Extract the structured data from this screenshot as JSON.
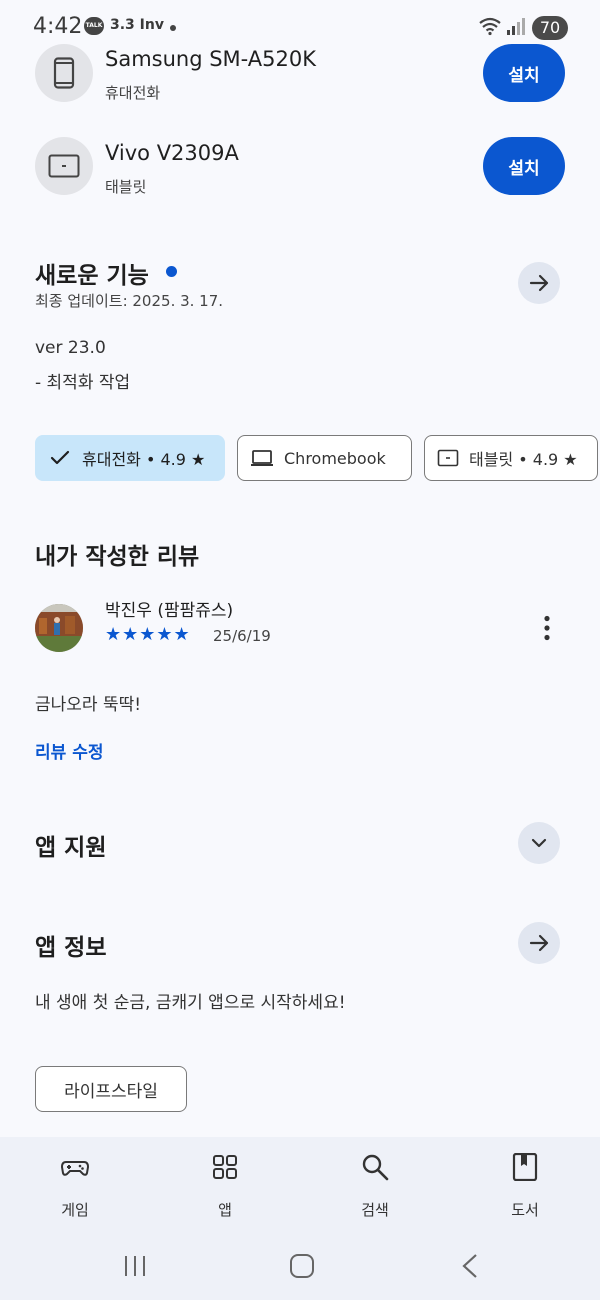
{
  "status_bar": {
    "time": "4:42",
    "talk_badge": "TALK",
    "indicators": "3.3 Inv",
    "battery": "70"
  },
  "devices": [
    {
      "name": "Samsung SM-A520K",
      "type": "휴대전화",
      "button": "설치",
      "icon": "phone-icon"
    },
    {
      "name": "Vivo V2309A",
      "type": "태블릿",
      "button": "설치",
      "icon": "tablet-icon"
    }
  ],
  "whats_new": {
    "title": "새로운 기능",
    "updated": "최종 업데이트: 2025. 3. 17.",
    "version": "ver 23.0",
    "note": "- 최적화 작업"
  },
  "chips": [
    {
      "label": "휴대전화 • 4.9 ★",
      "selected": true,
      "icon": "check-icon"
    },
    {
      "label": "Chromebook",
      "selected": false,
      "icon": "laptop-icon"
    },
    {
      "label": "태블릿 • 4.9 ★",
      "selected": false,
      "icon": "tablet-icon"
    }
  ],
  "my_review": {
    "title": "내가 작성한 리뷰",
    "reviewer": "박진우 (팜팜쥬스)",
    "rating": 5,
    "stars": "★★★★★",
    "date": "25/6/19",
    "text": "금나오라 뚝딱!",
    "edit_label": "리뷰 수정"
  },
  "app_support": {
    "title": "앱 지원"
  },
  "app_info": {
    "title": "앱 정보",
    "description": "내 생애 첫 순금, 금캐기 앱으로 시작하세요!",
    "category": "라이프스타일"
  },
  "bottom_nav": [
    {
      "label": "게임",
      "icon": "gamepad-icon"
    },
    {
      "label": "앱",
      "icon": "apps-grid-icon"
    },
    {
      "label": "검색",
      "icon": "search-icon"
    },
    {
      "label": "도서",
      "icon": "book-icon"
    }
  ],
  "colors": {
    "accent": "#0b57d0",
    "chip_selected": "#c8e6fa",
    "background": "#f8f9fd"
  }
}
